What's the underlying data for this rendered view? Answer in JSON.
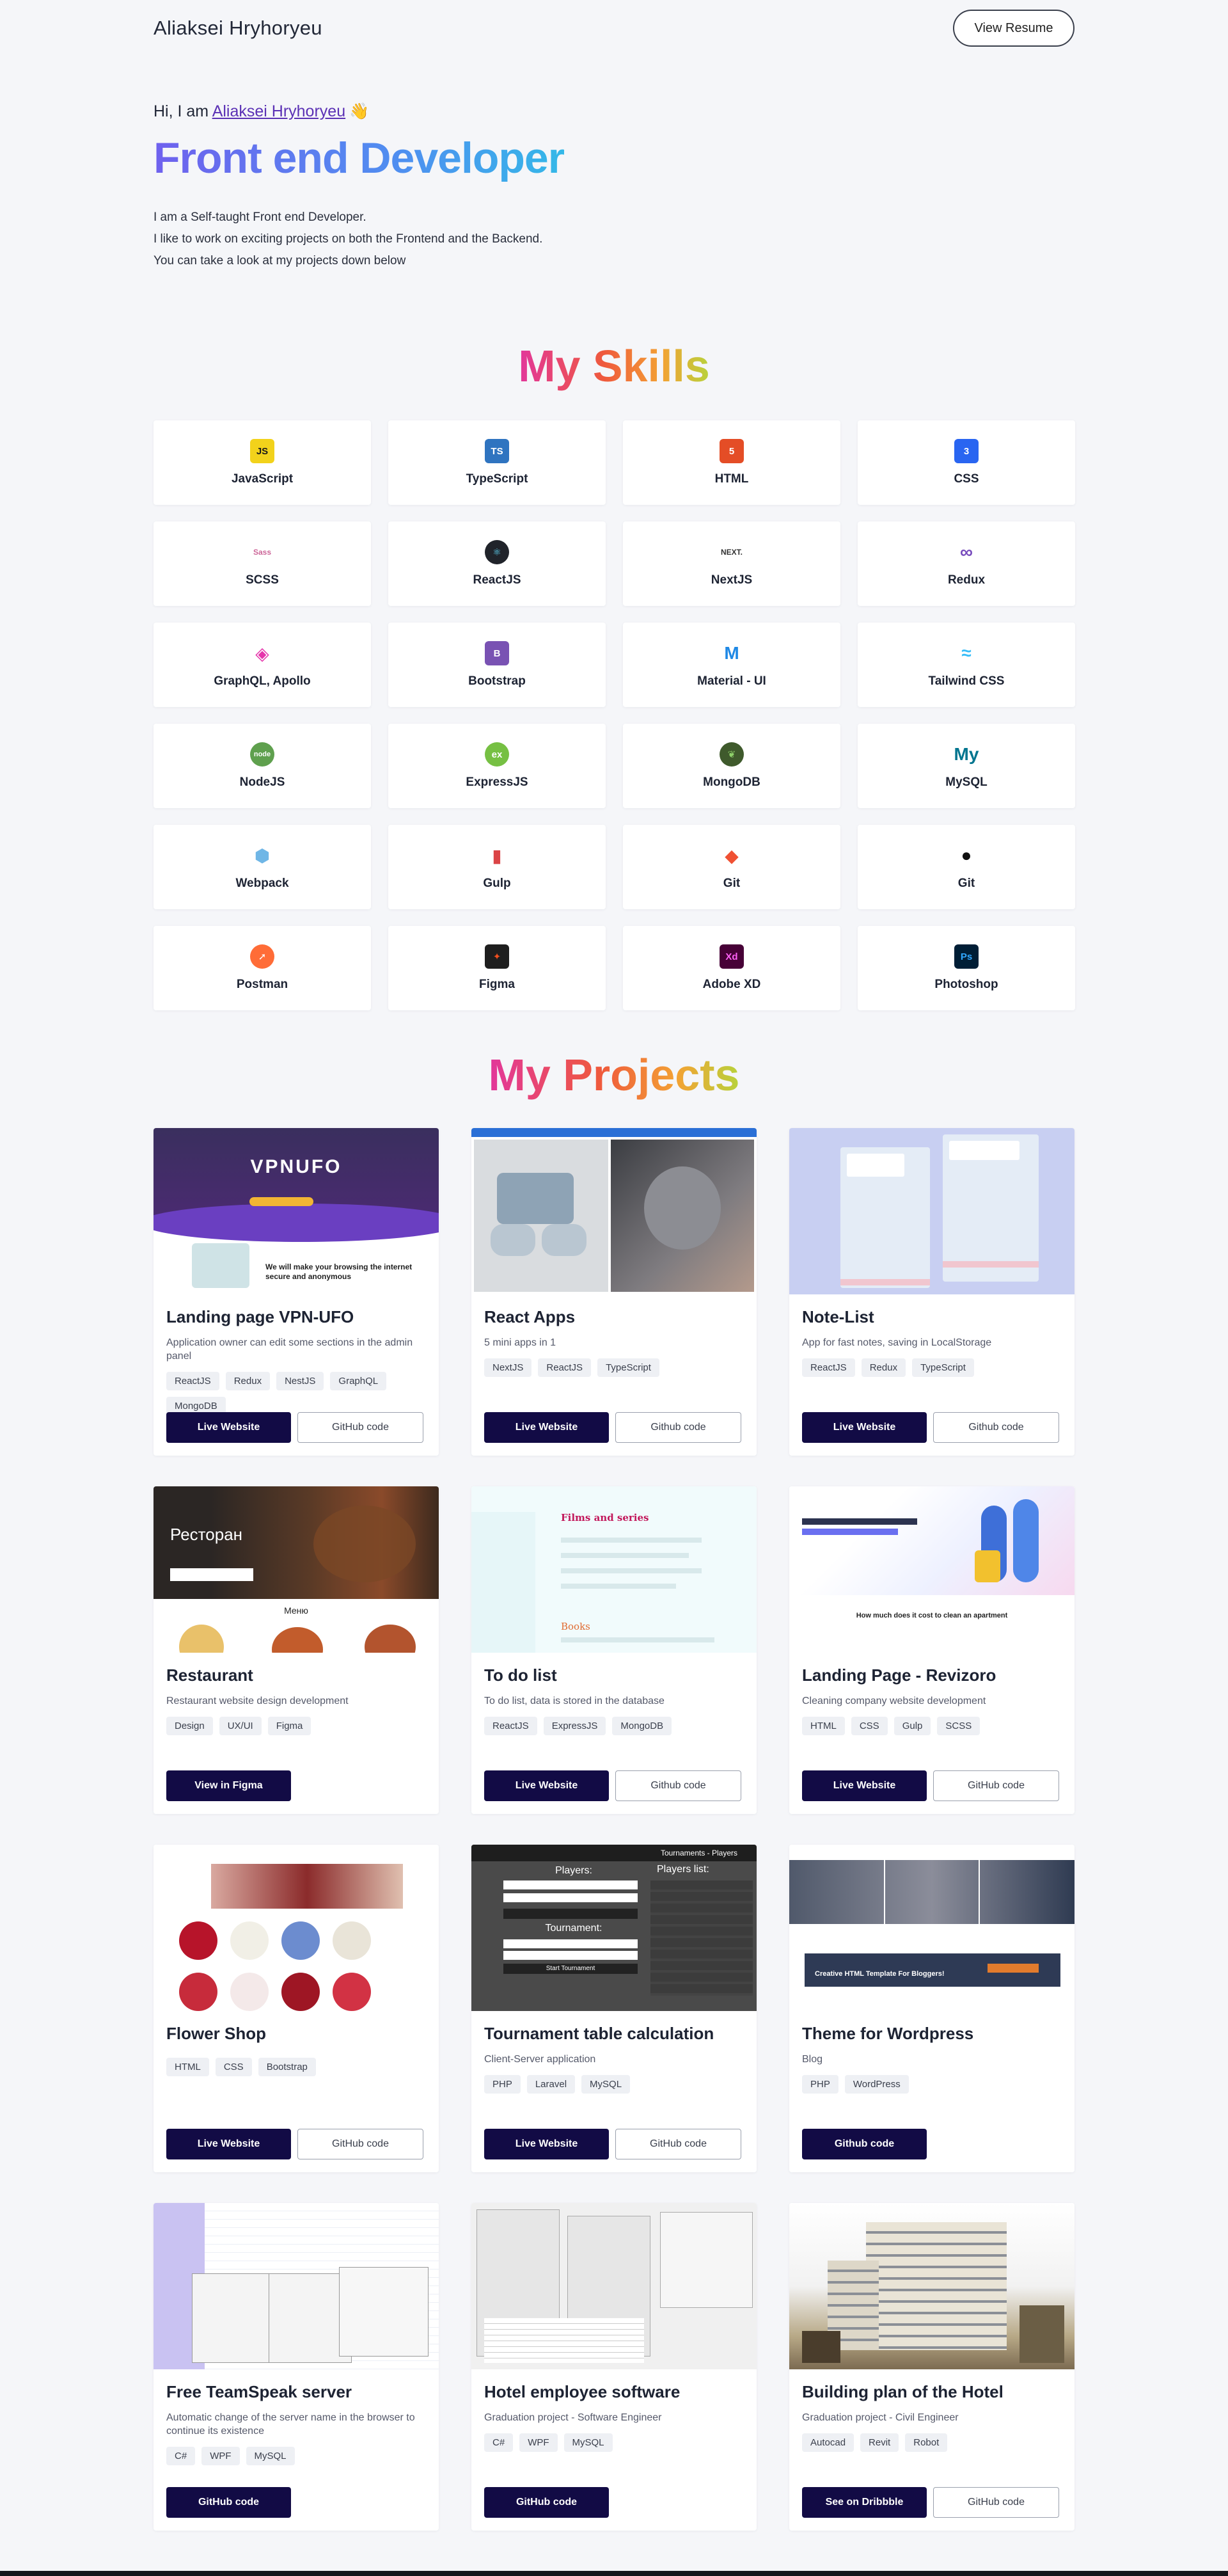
{
  "header": {
    "logo": "Aliaksei Hryhoryeu",
    "resume_label": "View Resume"
  },
  "hero": {
    "greet_prefix": "Hi, I am ",
    "name_link": "Aliaksei Hryhoryeu",
    "wave": "👋",
    "title": "Front end Developer",
    "intro": [
      "I am a Self-taught Front end Developer.",
      "I like to work on exciting projects on both the Frontend and the Backend.",
      "You can take a look at my projects down below"
    ]
  },
  "skills": {
    "title": "My Skills",
    "items": [
      {
        "label": "JavaScript",
        "icon": "javascript-icon",
        "glyph": "JS",
        "bg": "#f2d21b",
        "fg": "#1a1a1a",
        "shape": "square"
      },
      {
        "label": "TypeScript",
        "icon": "typescript-icon",
        "glyph": "TS",
        "bg": "#2f74c0",
        "fg": "#ffffff",
        "shape": "square"
      },
      {
        "label": "HTML",
        "icon": "html5-icon",
        "glyph": "5",
        "bg": "#e44d26",
        "fg": "#ffffff",
        "shape": "square"
      },
      {
        "label": "CSS",
        "icon": "css3-icon",
        "glyph": "3",
        "bg": "#2965f1",
        "fg": "#ffffff",
        "shape": "square"
      },
      {
        "label": "SCSS",
        "icon": "sass-icon",
        "glyph": "Sass",
        "bg": "#ffffff",
        "fg": "#cd6799",
        "shape": "square"
      },
      {
        "label": "ReactJS",
        "icon": "react-icon",
        "glyph": "⚛",
        "bg": "#20232a",
        "fg": "#61dafb",
        "shape": "round"
      },
      {
        "label": "NextJS",
        "icon": "nextjs-icon",
        "glyph": "NEXT.",
        "bg": "#ffffff",
        "fg": "#333333",
        "shape": "square"
      },
      {
        "label": "Redux",
        "icon": "redux-icon",
        "glyph": "∞",
        "bg": "#ffffff",
        "fg": "#764abc",
        "shape": "square"
      },
      {
        "label": "GraphQL, Apollo",
        "icon": "graphql-icon",
        "glyph": "◈",
        "bg": "#ffffff",
        "fg": "#e535ab",
        "shape": "square"
      },
      {
        "label": "Bootstrap",
        "icon": "bootstrap-icon",
        "glyph": "B",
        "bg": "#7952b3",
        "fg": "#ffffff",
        "shape": "square"
      },
      {
        "label": "Material - UI",
        "icon": "material-ui-icon",
        "glyph": "M",
        "bg": "#ffffff",
        "fg": "#1e88e5",
        "shape": "square"
      },
      {
        "label": "Tailwind CSS",
        "icon": "tailwind-icon",
        "glyph": "≈",
        "bg": "#ffffff",
        "fg": "#38bdf8",
        "shape": "square"
      },
      {
        "label": "NodeJS",
        "icon": "nodejs-icon",
        "glyph": "node",
        "bg": "#5fa04e",
        "fg": "#ffffff",
        "shape": "round"
      },
      {
        "label": "ExpressJS",
        "icon": "expressjs-icon",
        "glyph": "ex",
        "bg": "#76c043",
        "fg": "#ffffff",
        "shape": "round"
      },
      {
        "label": "MongoDB",
        "icon": "mongodb-icon",
        "glyph": "❦",
        "bg": "#3f5a2c",
        "fg": "#8fd16a",
        "shape": "round"
      },
      {
        "label": "MySQL",
        "icon": "mysql-icon",
        "glyph": "My",
        "bg": "#ffffff",
        "fg": "#00758f",
        "shape": "square"
      },
      {
        "label": "Webpack",
        "icon": "webpack-icon",
        "glyph": "⬢",
        "bg": "#ffffff",
        "fg": "#6fb6e6",
        "shape": "square"
      },
      {
        "label": "Gulp",
        "icon": "gulp-icon",
        "glyph": "▮",
        "bg": "#ffffff",
        "fg": "#db4446",
        "shape": "square"
      },
      {
        "label": "Git",
        "icon": "git-icon",
        "glyph": "◆",
        "bg": "#ffffff",
        "fg": "#f05133",
        "shape": "square"
      },
      {
        "label": "Git",
        "icon": "github-icon",
        "glyph": "●",
        "bg": "#ffffff",
        "fg": "#111111",
        "shape": "square"
      },
      {
        "label": "Postman",
        "icon": "postman-icon",
        "glyph": "➚",
        "bg": "#ff6c37",
        "fg": "#ffffff",
        "shape": "round"
      },
      {
        "label": "Figma",
        "icon": "figma-icon",
        "glyph": "✦",
        "bg": "#1e1e1e",
        "fg": "#f24e1e",
        "shape": "square"
      },
      {
        "label": "Adobe XD",
        "icon": "adobe-xd-icon",
        "glyph": "Xd",
        "bg": "#470137",
        "fg": "#ff61f6",
        "shape": "square"
      },
      {
        "label": "Photoshop",
        "icon": "photoshop-icon",
        "glyph": "Ps",
        "bg": "#001e36",
        "fg": "#31a8ff",
        "shape": "square"
      }
    ]
  },
  "projects": {
    "title": "My Projects",
    "items": [
      {
        "title": "Landing page VPN-UFO",
        "desc": "Application owner can edit some sections in the admin panel",
        "tags": [
          "ReactJS",
          "Redux",
          "NestJS",
          "GraphQL",
          "MongoDB"
        ],
        "primary": "Live Website",
        "secondary": "GitHub code",
        "thumb": "vpn",
        "thumb_text": [
          "VPNUFO",
          "We will make your browsing the internet secure and anonymous"
        ]
      },
      {
        "title": "React Apps",
        "desc": "5 mini apps in 1",
        "tags": [
          "NextJS",
          "ReactJS",
          "TypeScript"
        ],
        "primary": "Live Website",
        "secondary": "Github code",
        "thumb": "react-apps",
        "thumb_text": []
      },
      {
        "title": "Note-List",
        "desc": "App for fast notes, saving in LocalStorage",
        "tags": [
          "ReactJS",
          "Redux",
          "TypeScript"
        ],
        "primary": "Live Website",
        "secondary": "Github code",
        "thumb": "notes",
        "thumb_text": []
      },
      {
        "title": "Restaurant",
        "desc": "Restaurant website design development",
        "tags": [
          "Design",
          "UX/UI",
          "Figma"
        ],
        "primary": "View in Figma",
        "secondary": "",
        "thumb": "restaurant",
        "thumb_text": [
          "Ресторан",
          "Меню"
        ]
      },
      {
        "title": "To do list",
        "desc": "To do list, data is stored in the database",
        "tags": [
          "ReactJS",
          "ExpressJS",
          "MongoDB"
        ],
        "primary": "Live Website",
        "secondary": "Github code",
        "thumb": "todo",
        "thumb_text": [
          "Films and series",
          "Books"
        ]
      },
      {
        "title": "Landing Page - Revizoro",
        "desc": "Cleaning company website development",
        "tags": [
          "HTML",
          "CSS",
          "Gulp",
          "SCSS"
        ],
        "primary": "Live Website",
        "secondary": "GitHub code",
        "thumb": "revizoro",
        "thumb_text": [
          "How much does it cost to clean an apartment"
        ]
      },
      {
        "title": "Flower Shop",
        "desc": "",
        "tags": [
          "HTML",
          "CSS",
          "Bootstrap"
        ],
        "primary": "Live Website",
        "secondary": "GitHub code",
        "thumb": "flowers",
        "thumb_text": []
      },
      {
        "title": "Tournament table calculation",
        "desc": "Client-Server application",
        "tags": [
          "PHP",
          "Laravel",
          "MySQL"
        ],
        "primary": "Live Website",
        "secondary": "GitHub code",
        "thumb": "tournament",
        "thumb_text": [
          "Tournaments - Players",
          "Players:",
          "Players list:",
          "Tournament:",
          "Start Tournament"
        ]
      },
      {
        "title": "Theme for Wordpress",
        "desc": "Blog",
        "tags": [
          "PHP",
          "WordPress"
        ],
        "primary": "Github code",
        "secondary": "",
        "thumb": "wordpress",
        "thumb_text": [
          "Creative HTML Template For Bloggers!"
        ]
      },
      {
        "title": "Free TeamSpeak server",
        "desc": "Automatic change of the server name in the browser to continue its existence",
        "tags": [
          "C#",
          "WPF",
          "MySQL"
        ],
        "primary": "GitHub code",
        "secondary": "",
        "thumb": "teamspeak",
        "thumb_text": []
      },
      {
        "title": "Hotel employee software",
        "desc": "Graduation project - Software Engineer",
        "tags": [
          "C#",
          "WPF",
          "MySQL"
        ],
        "primary": "GitHub code",
        "secondary": "",
        "thumb": "hotel-software",
        "thumb_text": []
      },
      {
        "title": "Building plan of the Hotel",
        "desc": "Graduation project - Civil Engineer",
        "tags": [
          "Autocad",
          "Revit",
          "Robot"
        ],
        "primary": "See on Dribbble",
        "secondary": "GitHub code",
        "thumb": "building",
        "thumb_text": []
      }
    ]
  }
}
